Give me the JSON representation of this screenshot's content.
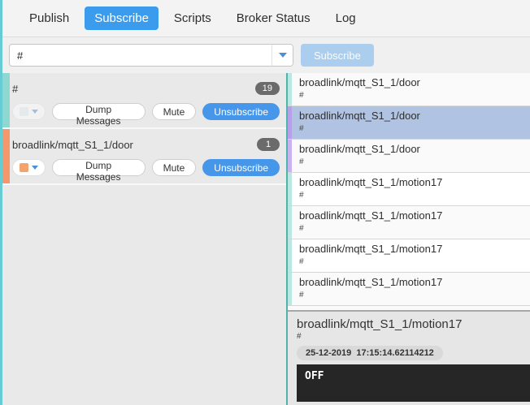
{
  "nav": {
    "tabs": [
      {
        "label": "Publish",
        "active": false
      },
      {
        "label": "Subscribe",
        "active": true
      },
      {
        "label": "Scripts",
        "active": false
      },
      {
        "label": "Broker Status",
        "active": false
      },
      {
        "label": "Log",
        "active": false
      }
    ]
  },
  "subscribe_bar": {
    "topic_value": "#",
    "subscribe_label": "Subscribe"
  },
  "subscription_actions": {
    "dump_label": "Dump Messages",
    "mute_label": "Mute",
    "unsubscribe_label": "Unsubscribe"
  },
  "subscriptions": [
    {
      "topic": "#",
      "count": "19",
      "bar_color": "#8ed8d2",
      "swatch_color": "#dfecea",
      "swatch_disabled": true
    },
    {
      "topic": "broadlink/mqtt_S1_1/door",
      "count": "1",
      "bar_color": "#f4986b",
      "swatch_color": "#f4a26e",
      "swatch_disabled": false
    }
  ],
  "messages": [
    {
      "topic": "broadlink/mqtt_S1_1/door",
      "matched_subscription": "#",
      "bar_color": "#b9e8e1",
      "selected": false
    },
    {
      "topic": "broadlink/mqtt_S1_1/door",
      "matched_subscription": "#",
      "bar_color": "#b89fe9",
      "selected": true
    },
    {
      "topic": "broadlink/mqtt_S1_1/door",
      "matched_subscription": "#",
      "bar_color": "#c9b2f2",
      "selected": false
    },
    {
      "topic": "broadlink/mqtt_S1_1/motion17",
      "matched_subscription": "#",
      "bar_color": "#b9e8e1",
      "selected": false
    },
    {
      "topic": "broadlink/mqtt_S1_1/motion17",
      "matched_subscription": "#",
      "bar_color": "#b9e8e1",
      "selected": false
    },
    {
      "topic": "broadlink/mqtt_S1_1/motion17",
      "matched_subscription": "#",
      "bar_color": "#b9e8e1",
      "selected": false
    },
    {
      "topic": "broadlink/mqtt_S1_1/motion17",
      "matched_subscription": "#",
      "bar_color": "#b9e8e1",
      "selected": false
    }
  ],
  "detail": {
    "topic": "broadlink/mqtt_S1_1/motion17",
    "matched_subscription": "#",
    "timestamp": "25-12-2019  17:15:14.62114212",
    "payload": "OFF"
  },
  "colors": {
    "accent_blue": "#3b9ced",
    "unsubscribe_blue": "#4697e9",
    "window_edge_teal": "#66cbd3",
    "panel_border_teal": "#52b3ab",
    "selected_row": "#b1c3e2",
    "badge_gray": "#6b6b6b",
    "payload_bg": "#262626"
  }
}
